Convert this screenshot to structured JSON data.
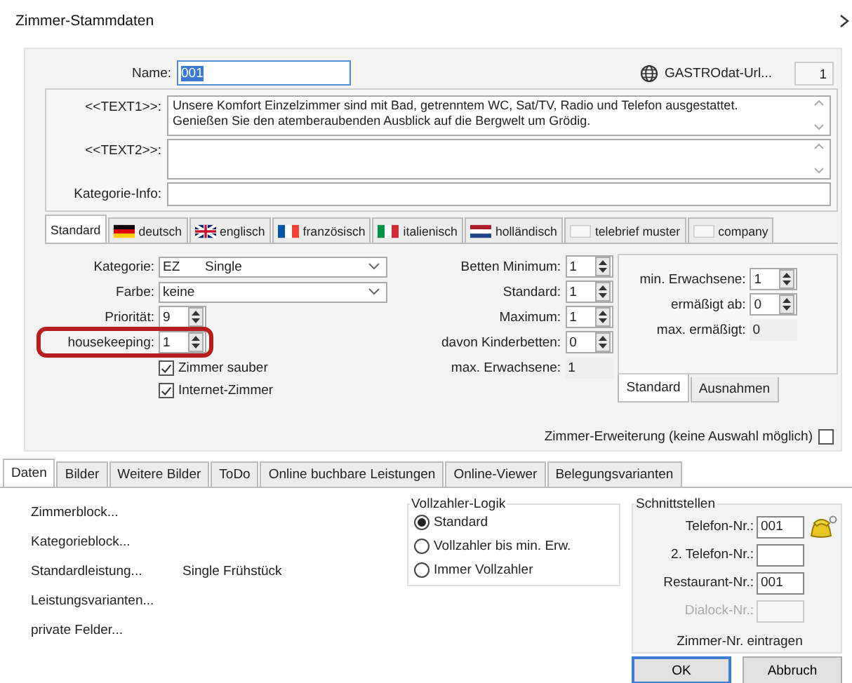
{
  "window": {
    "title": "Zimmer-Stammdaten"
  },
  "name_field": {
    "label": "Name:",
    "value": "001",
    "text_selected": true
  },
  "url_link": {
    "label": "GASTROdat-Url..."
  },
  "counter": "1",
  "texts": [
    {
      "label": "<<TEXT1>>:",
      "lines": [
        "Unsere Komfort Einzelzimmer sind mit Bad, getrenntem WC, Sat/TV, Radio und Telefon ausgestattet.",
        "Genießen Sie den atemberaubenden Ausblick auf die Bergwelt um Grödig."
      ]
    },
    {
      "label": "<<TEXT2>>:"
    }
  ],
  "kategorie_info": {
    "label": "Kategorie-Info:"
  },
  "language_tabs": [
    {
      "label": "Standard",
      "kind": "plain",
      "selected": true
    },
    {
      "label": "deutsch",
      "kind": "de",
      "selected": false
    },
    {
      "label": "englisch",
      "kind": "uk",
      "selected": false
    },
    {
      "label": "französisch",
      "kind": "fr",
      "selected": false
    },
    {
      "label": "italienisch",
      "kind": "it",
      "selected": false
    },
    {
      "label": "holländisch",
      "kind": "nl",
      "selected": false
    },
    {
      "label": "telebrief muster",
      "kind": "blank",
      "selected": false
    },
    {
      "label": "company",
      "kind": "blank",
      "selected": false
    }
  ],
  "room_fields": [
    {
      "label": "Kategorie:",
      "kind": "select",
      "code": "EZ",
      "value": "Single",
      "highlighted": false
    },
    {
      "label": "Farbe:",
      "kind": "select",
      "value": "keine",
      "highlighted": false
    },
    {
      "label": "Priorität:",
      "kind": "spinner",
      "value": "9",
      "highlighted": false
    },
    {
      "label": "housekeeping:",
      "kind": "spinner",
      "value": "1",
      "highlighted": true
    }
  ],
  "room_checks": [
    {
      "label": "Zimmer sauber",
      "checked": true
    },
    {
      "label": "Internet-Zimmer",
      "checked": true
    }
  ],
  "beds": [
    {
      "label": "Betten Minimum:",
      "kind": "spinner",
      "value": "1"
    },
    {
      "label": "Standard:",
      "kind": "spinner",
      "value": "1"
    },
    {
      "label": "Maximum:",
      "kind": "spinner",
      "value": "1"
    },
    {
      "label": "davon Kinderbetten:",
      "kind": "spinner",
      "value": "0"
    },
    {
      "label": "max. Erwachsene:",
      "kind": "readonly",
      "value": "1"
    }
  ],
  "adults_panel": {
    "fields": [
      {
        "label": "min. Erwachsene:",
        "kind": "spinner",
        "value": "1"
      },
      {
        "label": "ermäßigt ab:",
        "kind": "spinner",
        "value": "0"
      },
      {
        "label": "max. ermäßigt:",
        "kind": "readonly",
        "value": "0"
      }
    ],
    "tabs": [
      {
        "label": "Standard",
        "selected": true
      },
      {
        "label": "Ausnahmen",
        "selected": false
      }
    ]
  },
  "extension": {
    "label": "Zimmer-Erweiterung (keine Auswahl möglich)",
    "checked": false
  },
  "bottom_tabs": [
    {
      "label": "Daten",
      "selected": true
    },
    {
      "label": "Bilder",
      "selected": false
    },
    {
      "label": "Weitere Bilder",
      "selected": false
    },
    {
      "label": "ToDo",
      "selected": false
    },
    {
      "label": "Online buchbare Leistungen",
      "selected": false
    },
    {
      "label": "Online-Viewer",
      "selected": false
    },
    {
      "label": "Belegungsvarianten",
      "selected": false
    }
  ],
  "links": [
    {
      "label": "Zimmerblock..."
    },
    {
      "label": "Kategorieblock..."
    },
    {
      "label": "Standardleistung...",
      "value": "Single  Frühstück"
    },
    {
      "label": "Leistungsvarianten..."
    },
    {
      "label": "private Felder..."
    }
  ],
  "vollzahler": {
    "title": "Vollzahler-Logik",
    "options": [
      {
        "label": "Standard",
        "selected": true
      },
      {
        "label": "Vollzahler bis min. Erw.",
        "selected": false
      },
      {
        "label": "Immer Vollzahler",
        "selected": false
      }
    ]
  },
  "schnittstellen": {
    "title": "Schnittstellen",
    "fields": [
      {
        "label": "Telefon-Nr.:",
        "value": "001",
        "disabled": false,
        "phone": true
      },
      {
        "label": "2. Telefon-Nr.:",
        "disabled": false,
        "phone": false
      },
      {
        "label": "Restaurant-Nr.:",
        "value": "001",
        "disabled": false,
        "phone": false
      },
      {
        "label": "Dialock-Nr.:",
        "disabled": true,
        "phone": false
      }
    ],
    "note": "Zimmer-Nr. eintragen"
  },
  "buttons": [
    {
      "label": "OK",
      "default": true
    },
    {
      "label": "Abbruch",
      "default": false
    }
  ]
}
